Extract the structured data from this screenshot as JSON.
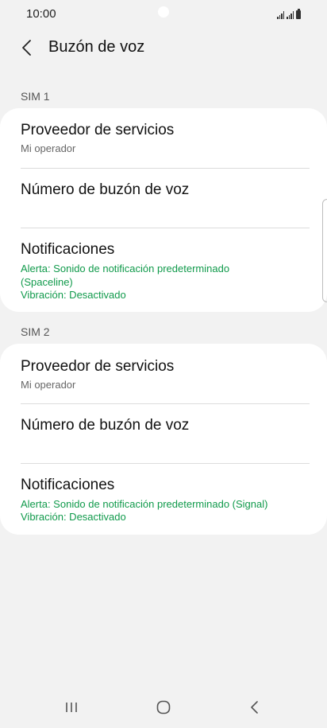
{
  "status_bar": {
    "time": "10:00"
  },
  "app_bar": {
    "title": "Buzón de voz",
    "back_icon": "chevron-left-icon"
  },
  "sections": [
    {
      "header": "SIM 1",
      "rows": [
        {
          "title": "Proveedor de servicios",
          "subtitle": "Mi operador"
        },
        {
          "title": "Número de buzón de voz"
        },
        {
          "title": "Notificaciones",
          "alert": "Alerta: Sonido de notificación predeterminado (Spaceline)",
          "vibration": "Vibración: Desactivado"
        }
      ]
    },
    {
      "header": "SIM 2",
      "rows": [
        {
          "title": "Proveedor de servicios",
          "subtitle": "Mi operador"
        },
        {
          "title": "Número de buzón de voz"
        },
        {
          "title": "Notificaciones",
          "alert": "Alerta: Sonido de notificación predeterminado (Signal)",
          "vibration": "Vibración: Desactivado"
        }
      ]
    }
  ],
  "colors": {
    "background": "#f2f2f2",
    "card": "#ffffff",
    "accent_green": "#109a4b"
  },
  "nav_bar": {
    "icons": [
      "recent-apps-icon",
      "home-icon",
      "back-icon"
    ]
  }
}
